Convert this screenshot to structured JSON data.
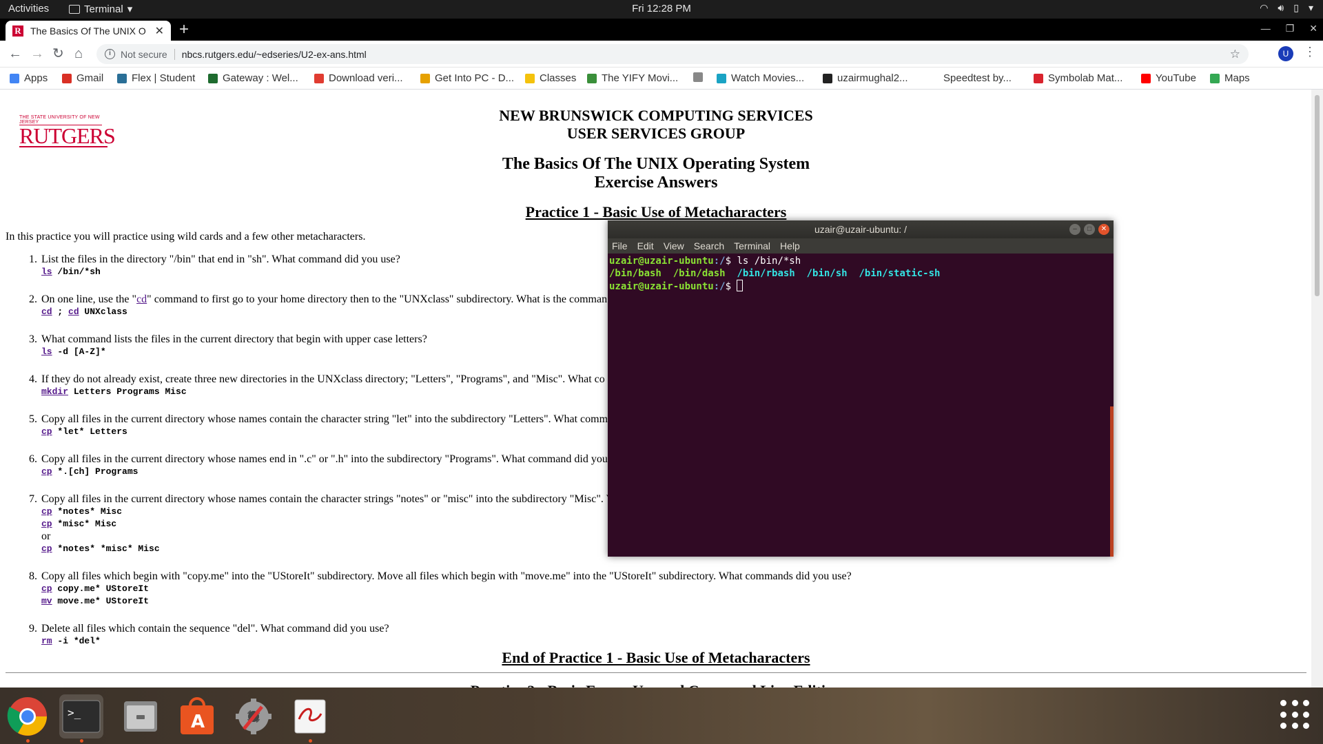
{
  "topbar": {
    "activities": "Activities",
    "app_name": "Terminal",
    "clock": "Fri 12:28 PM"
  },
  "browser": {
    "tab_title": "The Basics Of The UNIX O",
    "omnibox": {
      "security": "Not secure",
      "url": "nbcs.rutgers.edu/~edseries/U2-ex-ans.html"
    },
    "profile_initial": "U",
    "bookmarks": [
      {
        "label": "Apps",
        "color": "#4285f4"
      },
      {
        "label": "Gmail",
        "color": "#d93025"
      },
      {
        "label": "Flex | Student",
        "color": "#2a6f97"
      },
      {
        "label": "Gateway : Wel...",
        "color": "#1e6b2f"
      },
      {
        "label": "Download veri...",
        "color": "#e03c31"
      },
      {
        "label": "Get Into PC - D...",
        "color": "#e6a100"
      },
      {
        "label": "Classes",
        "color": "#f4c20d"
      },
      {
        "label": "The YIFY Movi...",
        "color": "#3a8f3a"
      },
      {
        "label": "",
        "color": "#888888"
      },
      {
        "label": "Watch Movies...",
        "color": "#1aa3c4"
      },
      {
        "label": "uzairmughal2...",
        "color": "#222222"
      },
      {
        "label": "Speedtest by...",
        "color": "#ffffff"
      },
      {
        "label": "Symbolab Mat...",
        "color": "#d9232d"
      },
      {
        "label": "YouTube",
        "color": "#ff0000"
      },
      {
        "label": "Maps",
        "color": "#34a853"
      }
    ]
  },
  "page": {
    "logo_small": "THE STATE UNIVERSITY OF NEW JERSEY",
    "logo_big": "RUTGERS",
    "org_line1": "NEW BRUNSWICK COMPUTING SERVICES",
    "org_line2": "USER SERVICES GROUP",
    "title_line1": "The Basics Of The UNIX Operating System",
    "title_line2": "Exercise Answers",
    "practice_heading": "Practice 1 - Basic Use of Metacharacters",
    "intro": "In this practice you will practice using wild cards and a few other metacharacters.",
    "questions": [
      {
        "num": "1.",
        "text": "List the files in the directory \"/bin\" that end in \"sh\". What command did you use?"
      },
      {
        "num": "2.",
        "text_a": "On one line, use the \"",
        "link": "cd",
        "text_b": "\" command to first go to your home directory then to the \"UNXclass\" subdirectory. What is the comman"
      },
      {
        "num": "3.",
        "text": "What command lists the files in the current directory that begin with upper case letters?"
      },
      {
        "num": "4.",
        "text": "If they do not already exist, create three new directories in the UNXclass directory; \"Letters\", \"Programs\", and \"Misc\". What co"
      },
      {
        "num": "5.",
        "text": "Copy all files in the current directory whose names contain the character string \"let\" into the subdirectory \"Letters\". What comm"
      },
      {
        "num": "6.",
        "text": "Copy all files in the current directory whose names end in \".c\" or \".h\" into the subdirectory \"Programs\". What command did you"
      },
      {
        "num": "7.",
        "text": "Copy all files in the current directory whose names contain the character strings \"notes\" or \"misc\" into the subdirectory \"Misc\". V"
      },
      {
        "num": "8.",
        "text": "Copy all files which begin with \"copy.me\" into the \"UStoreIt\" subdirectory. Move all files which begin with \"move.me\" into the \"UStoreIt\" subdirectory. What commands did you use?"
      },
      {
        "num": "9.",
        "text": "Delete all files which contain the sequence \"del\". What command did you use?"
      }
    ],
    "answers": {
      "q1": {
        "cmd": "ls",
        "args": " /bin/*sh"
      },
      "q2": {
        "cmd1": "cd",
        "mid": " ; ",
        "cmd2": "cd",
        "args": " UNXclass"
      },
      "q3": {
        "cmd": "ls",
        "args": " -d [A-Z]*"
      },
      "q4": {
        "cmd": "mkdir",
        "args": " Letters Programs Misc"
      },
      "q5": {
        "cmd": "cp",
        "args": " *let* Letters"
      },
      "q6": {
        "cmd": "cp",
        "args": " *.[ch] Programs"
      },
      "q7": {
        "line1_cmd": "cp",
        "line1_args": " *notes* Misc",
        "line2_cmd": "cp",
        "line2_args": " *misc* Misc",
        "or": "or",
        "line3_cmd": "cp",
        "line3_args": " *notes* *misc* Misc"
      },
      "q8": {
        "line1_cmd": "cp",
        "line1_args": " copy.me* UStoreIt",
        "line2_cmd": "mv",
        "line2_args": " move.me* UStoreIt"
      },
      "q9": {
        "cmd": "rm",
        "args": " -i *del*"
      }
    },
    "end_heading": "End of Practice 1 - Basic Use of Metacharacters",
    "next_heading_partial": "Practice 2 - Basic Emacs Use and Command Line Editing"
  },
  "terminal": {
    "title": "uzair@uzair-ubuntu: /",
    "menu": [
      "File",
      "Edit",
      "View",
      "Search",
      "Terminal",
      "Help"
    ],
    "prompt_user": "uzair@uzair-ubuntu",
    "prompt_path": ":/",
    "prompt_sign": "$ ",
    "command": "ls /bin/*sh",
    "output": [
      {
        "text": "/bin/bash",
        "color": "green"
      },
      {
        "text": "/bin/dash",
        "color": "green"
      },
      {
        "text": "/bin/rbash",
        "color": "cyan"
      },
      {
        "text": "/bin/sh",
        "color": "cyan"
      },
      {
        "text": "/bin/static-sh",
        "color": "cyan"
      }
    ]
  },
  "dock": {
    "items": [
      "chrome-icon",
      "terminal-icon",
      "files-icon",
      "software-center-icon",
      "settings-icon",
      "text-editor-icon"
    ]
  }
}
